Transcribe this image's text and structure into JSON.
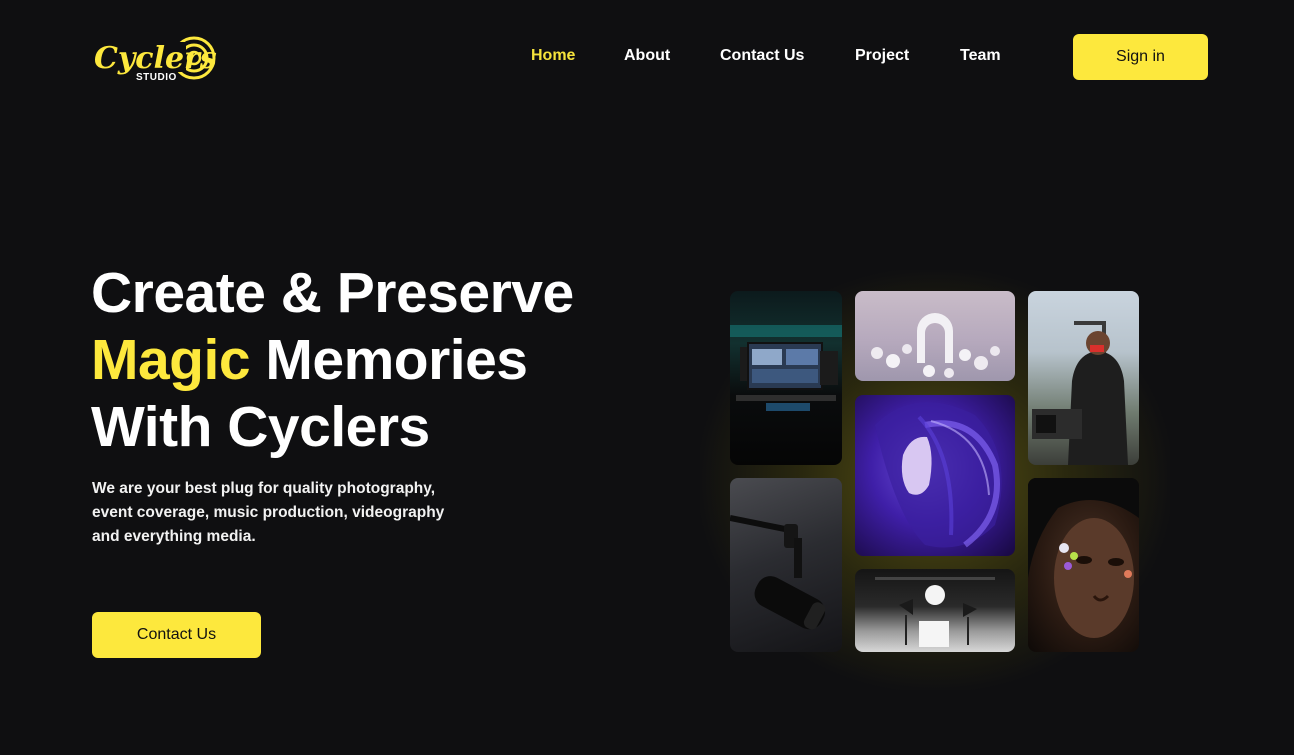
{
  "brand": {
    "logo_text": "Cyclers",
    "logo_subtext": "STUDIO",
    "accent_color": "#fde83d",
    "background_color": "#0f0f11"
  },
  "nav": {
    "items": [
      {
        "label": "Home",
        "active": true
      },
      {
        "label": "About",
        "active": false
      },
      {
        "label": "Contact Us",
        "active": false
      },
      {
        "label": "Project",
        "active": false
      },
      {
        "label": "Team",
        "active": false
      }
    ],
    "signin_label": "Sign in"
  },
  "hero": {
    "title_line1": "Create & Preserve",
    "title_accent": "Magic",
    "title_line2_rest": " Memories",
    "title_line3": "With Cyclers",
    "subtitle": "We are your best plug for quality photography, event coverage, music production, videography and everything media.",
    "cta_label": "Contact Us"
  },
  "gallery": {
    "tiles": [
      {
        "subject": "music studio workstation"
      },
      {
        "subject": "3D arch with spheres"
      },
      {
        "subject": "videographer with camera"
      },
      {
        "subject": "studio microphone"
      },
      {
        "subject": "woman with purple light"
      },
      {
        "subject": "photo studio lights"
      },
      {
        "subject": "portrait with flowers"
      }
    ]
  }
}
